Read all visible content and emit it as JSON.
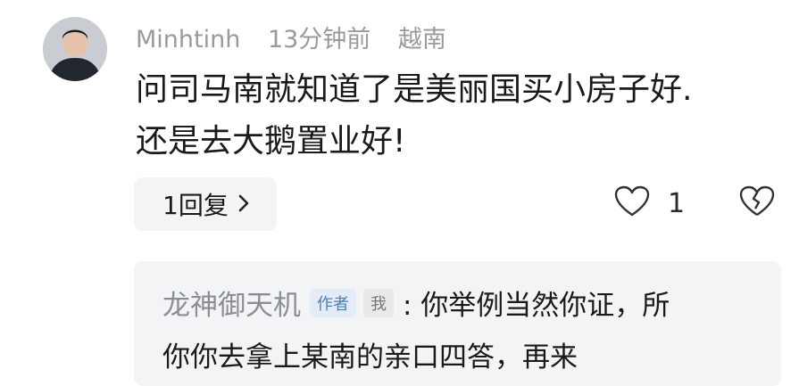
{
  "comment": {
    "username": "Minhtinh",
    "time": "13分钟前",
    "location": "越南",
    "text_line1": "问司马南就知道了是美丽国买小房子好.",
    "text_line2": "还是去大鹅置业好!",
    "reply_count_label": "1回复",
    "like_count": "1",
    "icons": {
      "avatar": "avatar",
      "like": "heart-icon",
      "dislike": "broken-heart-icon",
      "expand": "chevron-right-icon"
    }
  },
  "reply": {
    "author": "龙神御天机",
    "badge_author": "作者",
    "badge_me": "我",
    "text_line1": ": 你举例当然你证，所",
    "text_line2": "你你去拿上某南的亲口四答，再来"
  }
}
